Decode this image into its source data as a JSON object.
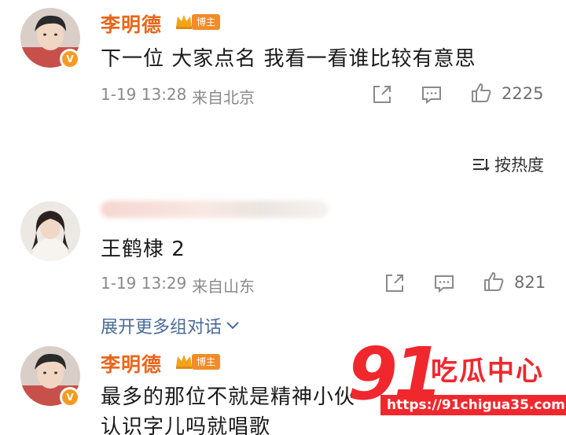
{
  "comments": [
    {
      "username": "李明德",
      "role_badge": "博主",
      "text": "下一位 大家点名 我看一看谁比较有意思",
      "time": "1-19 13:28",
      "location": "来自北京",
      "likes": "2225"
    },
    {
      "text": "王鹤棣 2",
      "time": "1-19 13:29",
      "location": "来自山东",
      "likes": "821"
    },
    {
      "username": "李明德",
      "role_badge": "博主",
      "text_line1": "最多的那位不就是精神小伙",
      "text_line2": "认识字儿吗就唱歌"
    }
  ],
  "sort": {
    "label": "按热度"
  },
  "expand": {
    "label": "展开更多组对话"
  },
  "watermark": {
    "number": "91",
    "brand": "吃瓜中心",
    "url": "https://91chigua35.com"
  },
  "colors": {
    "username": "#e8661a",
    "badge": "#f28c28",
    "watermark": "#f0282e",
    "link": "#4a6a9a"
  }
}
